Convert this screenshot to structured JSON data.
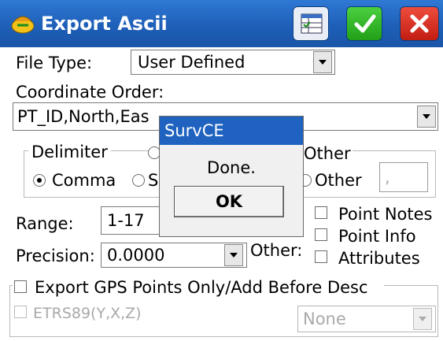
{
  "window": {
    "title": "Export Ascii"
  },
  "file_type": {
    "label": "File Type:",
    "value": "User Defined"
  },
  "coordinate_order": {
    "label": "Coordinate Order:",
    "value": "PT_ID,North,Eas"
  },
  "delimiter": {
    "group_label": "Delimiter",
    "options": [
      {
        "label": "Comma",
        "selected": true
      },
      {
        "label": "S",
        "selected": false
      }
    ]
  },
  "other_group": {
    "label": "Other",
    "option_label": "Other",
    "field_value": ","
  },
  "range": {
    "label": "Range:",
    "value": "1-17"
  },
  "precision": {
    "label": "Precision:",
    "value": "0.0000"
  },
  "other_label": "Other:",
  "options": [
    {
      "label": "Point Notes",
      "checked": false
    },
    {
      "label": "Point Info",
      "checked": false
    },
    {
      "label": "Attributes",
      "checked": false
    }
  ],
  "export_gps": {
    "label": "Export GPS Points Only/Add Before Desc",
    "checked": false
  },
  "etrs": {
    "label": "ETRS89(Y,X,Z)",
    "checked": false,
    "enabled": false,
    "combo_value": "None"
  },
  "dialog": {
    "title": "SurvCE",
    "message": "Done.",
    "button_label": "OK"
  },
  "colors": {
    "title_bar": "#1e5fb8",
    "ok_green": "#22a018",
    "close_red": "#c21d12"
  }
}
